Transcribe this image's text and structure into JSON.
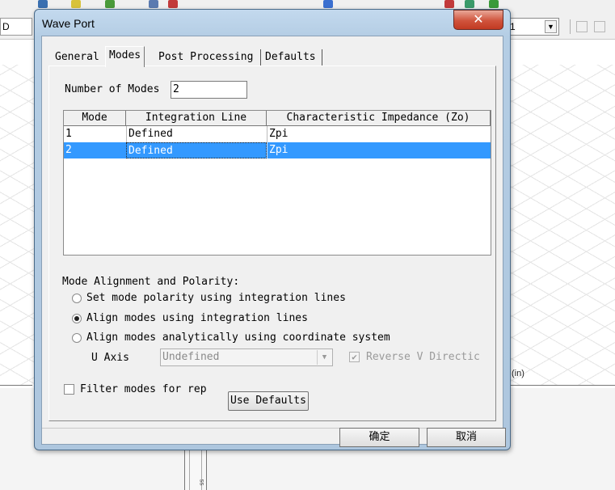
{
  "background_app": {
    "left_combo_value": "D",
    "right_combo_value": "1",
    "unit_label": "(in)",
    "splitter_text": "ss"
  },
  "dialog": {
    "title": "Wave Port",
    "close_glyph": "✕",
    "tabs": [
      {
        "label": "General",
        "active": false
      },
      {
        "label": "Modes",
        "active": true
      },
      {
        "label": "Post Processing",
        "active": false
      },
      {
        "label": "Defaults",
        "active": false
      }
    ],
    "modes_tab": {
      "number_of_modes_label": "Number of Modes",
      "number_of_modes_value": "2",
      "grid": {
        "columns": [
          "Mode",
          "Integration Line",
          "Characteristic Impedance (Zo)"
        ],
        "rows": [
          {
            "mode": "1",
            "integration_line": "Defined",
            "impedance": "Zpi",
            "selected": false
          },
          {
            "mode": "2",
            "integration_line": "Defined",
            "impedance": "Zpi",
            "selected": true
          }
        ]
      },
      "alignment_section_label": "Mode Alignment and Polarity:",
      "alignment_options": [
        {
          "label": "Set mode polarity using integration lines",
          "checked": false
        },
        {
          "label": "Align modes using integration lines",
          "checked": true
        },
        {
          "label": "Align modes analytically using coordinate system",
          "checked": false
        }
      ],
      "u_axis_label": "U Axis",
      "u_axis_value": "Undefined",
      "reverse_v_label": "Reverse V Directic",
      "reverse_v_checked": true,
      "filter_modes_label": "Filter modes for rep",
      "filter_modes_checked": false,
      "use_defaults_label": "Use Defaults"
    },
    "ok_label": "确定",
    "cancel_label": "取消"
  }
}
